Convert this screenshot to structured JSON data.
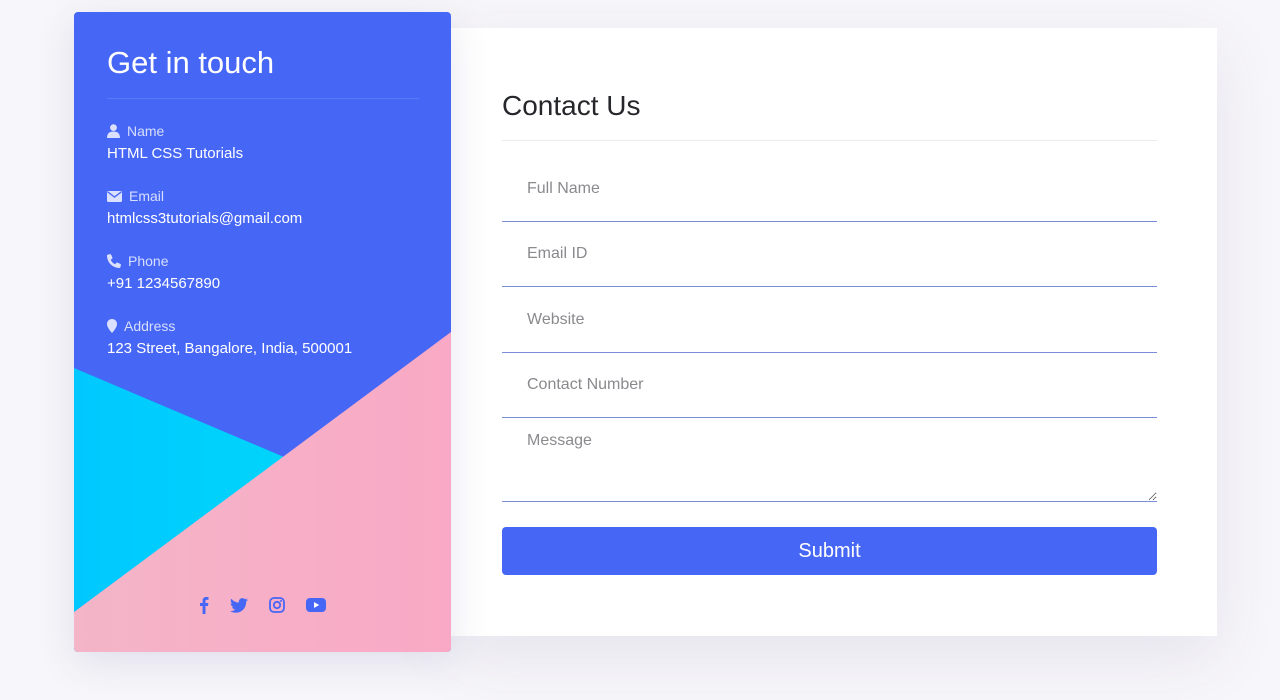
{
  "info": {
    "title": "Get in touch",
    "items": [
      {
        "icon": "user-icon",
        "label": "Name",
        "value": "HTML CSS Tutorials"
      },
      {
        "icon": "envelope-icon",
        "label": "Email",
        "value": "htmlcss3tutorials@gmail.com"
      },
      {
        "icon": "phone-icon",
        "label": "Phone",
        "value": "+91 1234567890"
      },
      {
        "icon": "map-marker-icon",
        "label": "Address",
        "value": "123 Street, Bangalore, India, 500001"
      }
    ],
    "social": [
      "facebook-icon",
      "twitter-icon",
      "instagram-icon",
      "youtube-icon"
    ]
  },
  "form": {
    "title": "Contact Us",
    "fields": [
      {
        "placeholder": "Full Name",
        "value": ""
      },
      {
        "placeholder": "Email ID",
        "value": ""
      },
      {
        "placeholder": "Website",
        "value": ""
      },
      {
        "placeholder": "Contact Number",
        "value": ""
      },
      {
        "placeholder": "Message",
        "value": ""
      }
    ],
    "submit_label": "Submit"
  },
  "colors": {
    "primary": "#4666f6",
    "cyan_shape": "#00cfff",
    "pink_shape": "#f9aac5",
    "page_bg": "#f7f6fa"
  }
}
